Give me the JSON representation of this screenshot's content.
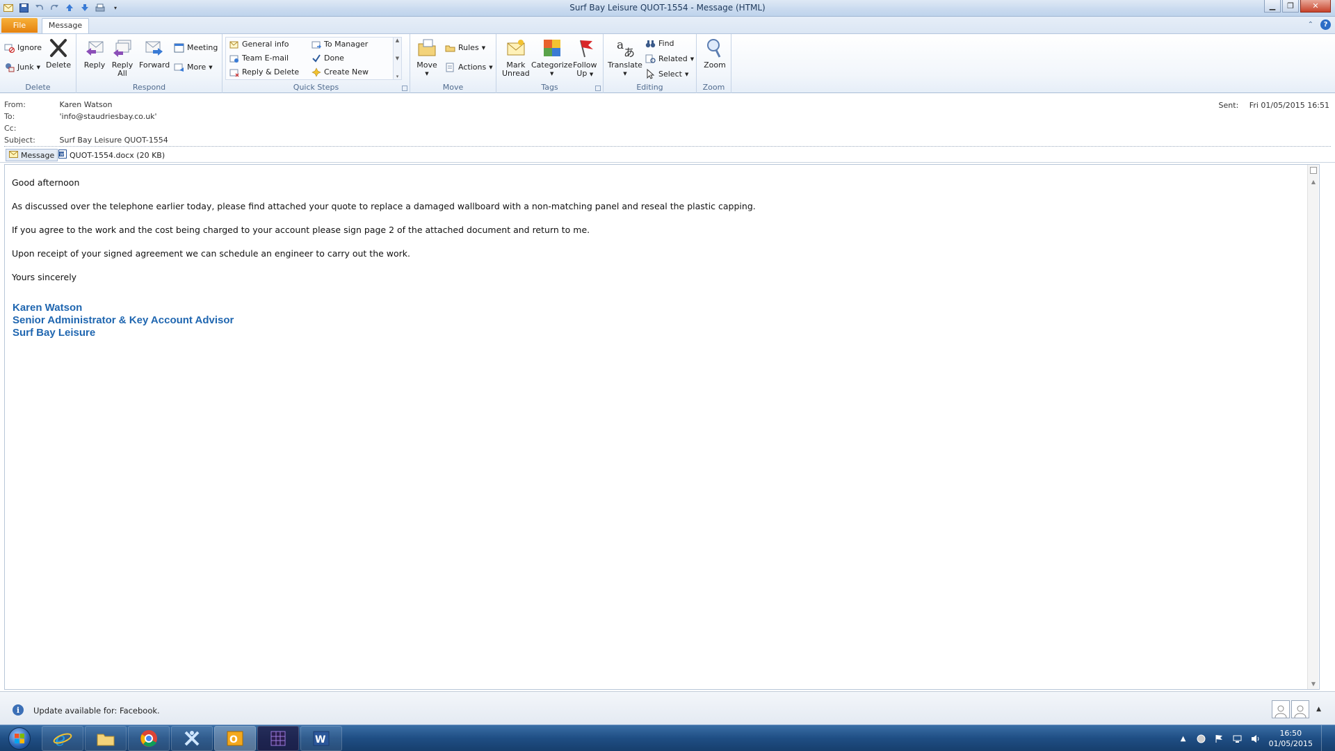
{
  "window": {
    "title": "Surf Bay Leisure QUOT-1554 - Message (HTML)"
  },
  "tabs": {
    "file": "File",
    "message": "Message"
  },
  "ribbon": {
    "delete_group": {
      "label": "Delete",
      "ignore": "Ignore",
      "junk": "Junk",
      "delete": "Delete"
    },
    "respond_group": {
      "label": "Respond",
      "reply": "Reply",
      "reply_all_1": "Reply",
      "reply_all_2": "All",
      "forward": "Forward",
      "meeting": "Meeting",
      "more": "More"
    },
    "quick_steps_group": {
      "label": "Quick Steps",
      "items": [
        "General info",
        "Team E-mail",
        "Reply & Delete",
        "To Manager",
        "Done",
        "Create New"
      ]
    },
    "move_group": {
      "label": "Move",
      "move": "Move",
      "rules": "Rules",
      "actions": "Actions"
    },
    "tags_group": {
      "label": "Tags",
      "mark_unread_1": "Mark",
      "mark_unread_2": "Unread",
      "categorize": "Categorize",
      "follow_up_1": "Follow",
      "follow_up_2": "Up"
    },
    "editing_group": {
      "label": "Editing",
      "translate": "Translate",
      "find": "Find",
      "related": "Related",
      "select": "Select"
    },
    "zoom_group": {
      "label": "Zoom",
      "zoom": "Zoom"
    }
  },
  "header": {
    "from_label": "From:",
    "from_value": "Karen Watson",
    "to_label": "To:",
    "to_value": "'info@staudriesbay.co.uk'",
    "cc_label": "Cc:",
    "cc_value": "",
    "subject_label": "Subject:",
    "subject_value": "Surf Bay Leisure QUOT-1554",
    "sent_label": "Sent:",
    "sent_value": "Fri 01/05/2015 16:51"
  },
  "attachments": {
    "message_tab": "Message",
    "file": "QUOT-1554.docx (20 KB)"
  },
  "body": {
    "greeting": "Good afternoon",
    "p1": "As discussed over the telephone earlier today, please find attached your quote to replace a damaged wallboard with a non-matching panel and reseal the plastic capping.",
    "p2": "If you agree to the work and the cost being charged to your account please sign page 2 of the attached document and return to me.",
    "p3": "Upon receipt of your signed agreement we can schedule an engineer to carry out the work.",
    "closing": "Yours sincerely",
    "sig_name": "Karen Watson",
    "sig_title": "Senior Administrator & Key Account Advisor",
    "sig_company": "Surf Bay Leisure"
  },
  "notification": {
    "text": "Update available for: Facebook."
  },
  "taskbar": {
    "apps": [
      "internet-explorer",
      "file-explorer",
      "chrome",
      "app-x",
      "outlook",
      "calendar-app",
      "word"
    ],
    "time": "16:50",
    "date": "01/05/2015"
  },
  "colors": {
    "signature": "#1f66b0",
    "file_tab": "#e5820f",
    "taskbar": "#1f4e84"
  }
}
